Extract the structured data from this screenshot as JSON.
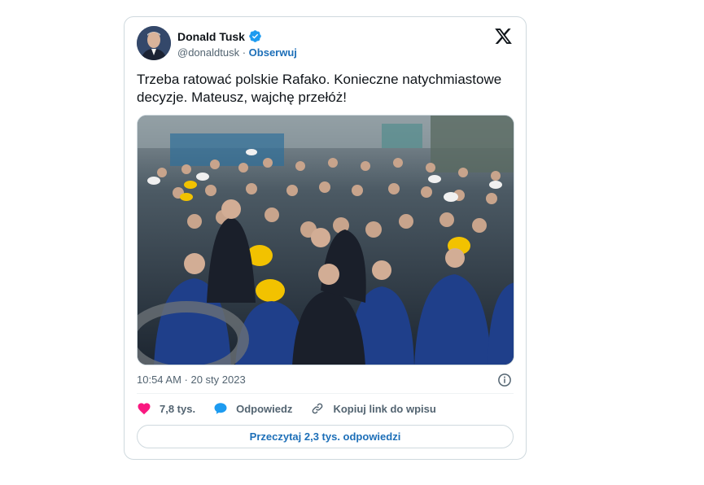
{
  "tweet": {
    "author": {
      "name": "Donald Tusk",
      "handle": "@donaldtusk",
      "separator": "·",
      "follow_label": "Obserwuj",
      "verified": true
    },
    "text": "Trzeba ratować polskie Rafako. Konieczne natychmiastowe decyzje. Mateusz, wajchę przełóż!",
    "timestamp": "10:54 AM · 20 sty 2023",
    "actions": {
      "likes": "7,8 tys.",
      "reply_label": "Odpowiedz",
      "copy_link_label": "Kopiuj link do wpisu"
    },
    "read_replies_label": "Przeczytaj 2,3 tys. odpowiedzi"
  },
  "colors": {
    "accent_blue": "#1d6fb8",
    "verified_blue": "#1d9bf0",
    "like_pink": "#f91880",
    "reply_blue": "#1d9bf0",
    "muted_text": "#536471",
    "border": "#cfd9de"
  },
  "icons": {
    "brand": "x-logo-icon",
    "verified": "verified-badge-icon",
    "info": "info-icon",
    "like": "heart-icon",
    "reply": "speech-bubble-icon",
    "copy_link": "link-icon"
  }
}
